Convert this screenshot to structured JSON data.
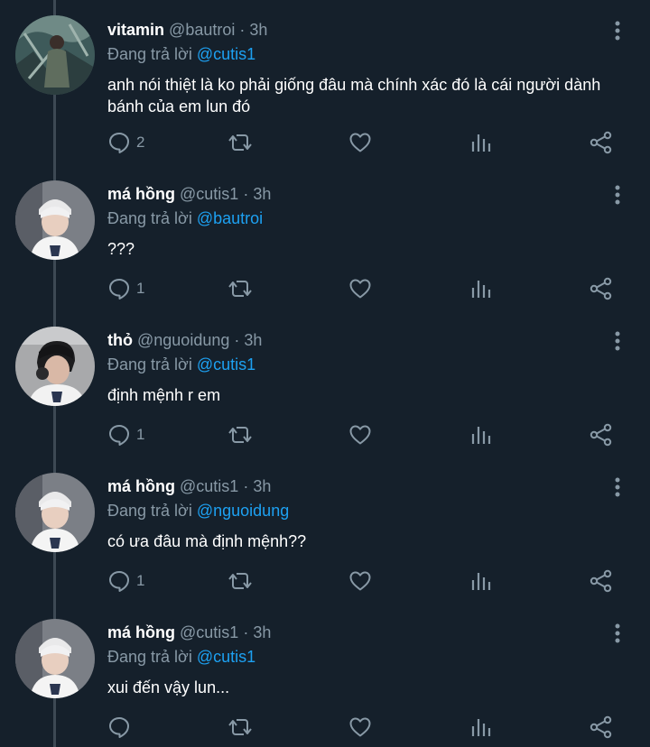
{
  "tweets": [
    {
      "name": "vitamin",
      "handle": "@bautroi",
      "time": "3h",
      "reply_prefix": "Đang trả lời",
      "reply_to": "@cutis1",
      "text": "anh nói thiệt là ko phải giống đâu mà chính xác đó là cái người dành bánh của em lun đó",
      "reply_count": "2"
    },
    {
      "name": "má hồng",
      "handle": "@cutis1",
      "time": "3h",
      "reply_prefix": "Đang trả lời",
      "reply_to": "@bautroi",
      "text": "???",
      "reply_count": "1"
    },
    {
      "name": "thỏ",
      "handle": "@nguoidung",
      "time": "3h",
      "reply_prefix": "Đang trả lời",
      "reply_to": "@cutis1",
      "text": "định mệnh r em",
      "reply_count": "1"
    },
    {
      "name": "má hồng",
      "handle": "@cutis1",
      "time": "3h",
      "reply_prefix": "Đang trả lời",
      "reply_to": "@nguoidung",
      "text": "có ưa đâu mà định mệnh??",
      "reply_count": "1"
    },
    {
      "name": "má hồng",
      "handle": "@cutis1",
      "time": "3h",
      "reply_prefix": "Đang trả lời",
      "reply_to": "@cutis1",
      "text": "xui đến vậy lun...",
      "reply_count": ""
    }
  ],
  "separator": "·",
  "icons": {
    "reply": "reply-icon",
    "retweet": "retweet-icon",
    "like": "heart-icon",
    "stats": "stats-icon",
    "share": "share-icon",
    "more": "more-vertical-icon"
  },
  "colors": {
    "background": "#15202b",
    "muted": "#8899a6",
    "mention": "#1da1f2",
    "thread_line": "#3d4954"
  }
}
